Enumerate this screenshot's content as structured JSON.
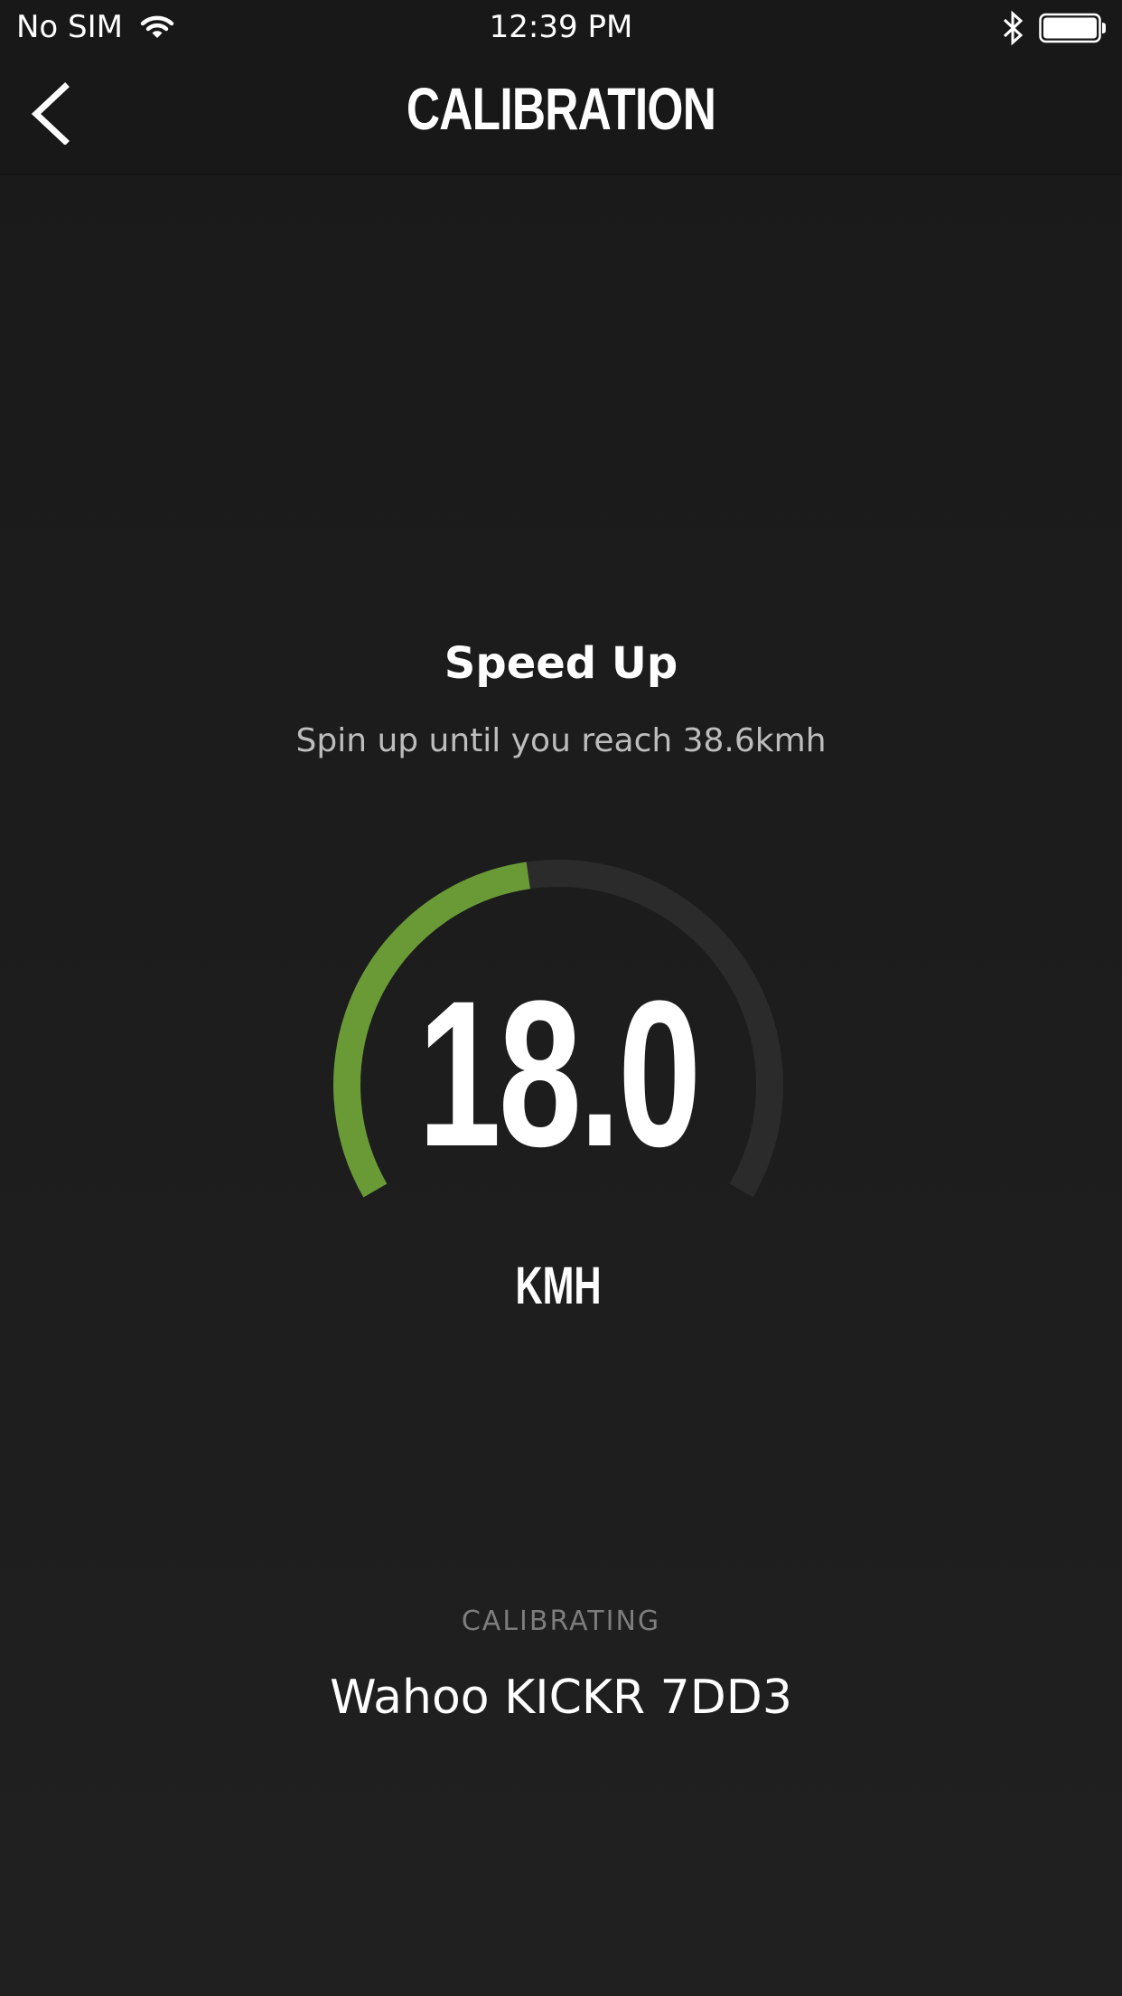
{
  "status_bar": {
    "carrier": "No SIM",
    "time": "12:39 PM",
    "icons": [
      "wifi-icon",
      "bluetooth-icon",
      "battery-icon"
    ]
  },
  "nav": {
    "title": "CALIBRATION",
    "back_icon": "chevron-left-icon"
  },
  "step": {
    "title": "Speed Up",
    "subtitle": "Spin up until you reach 38.6kmh"
  },
  "gauge": {
    "value": "18.0",
    "unit": "KMH",
    "current_speed": 18.0,
    "target_speed": 38.6,
    "progress_fraction": 0.466,
    "colors": {
      "progress": "#6a9a36",
      "track": "#2b2b2b"
    }
  },
  "device": {
    "status_label": "CALIBRATING",
    "name": "Wahoo KICKR 7DD3"
  }
}
